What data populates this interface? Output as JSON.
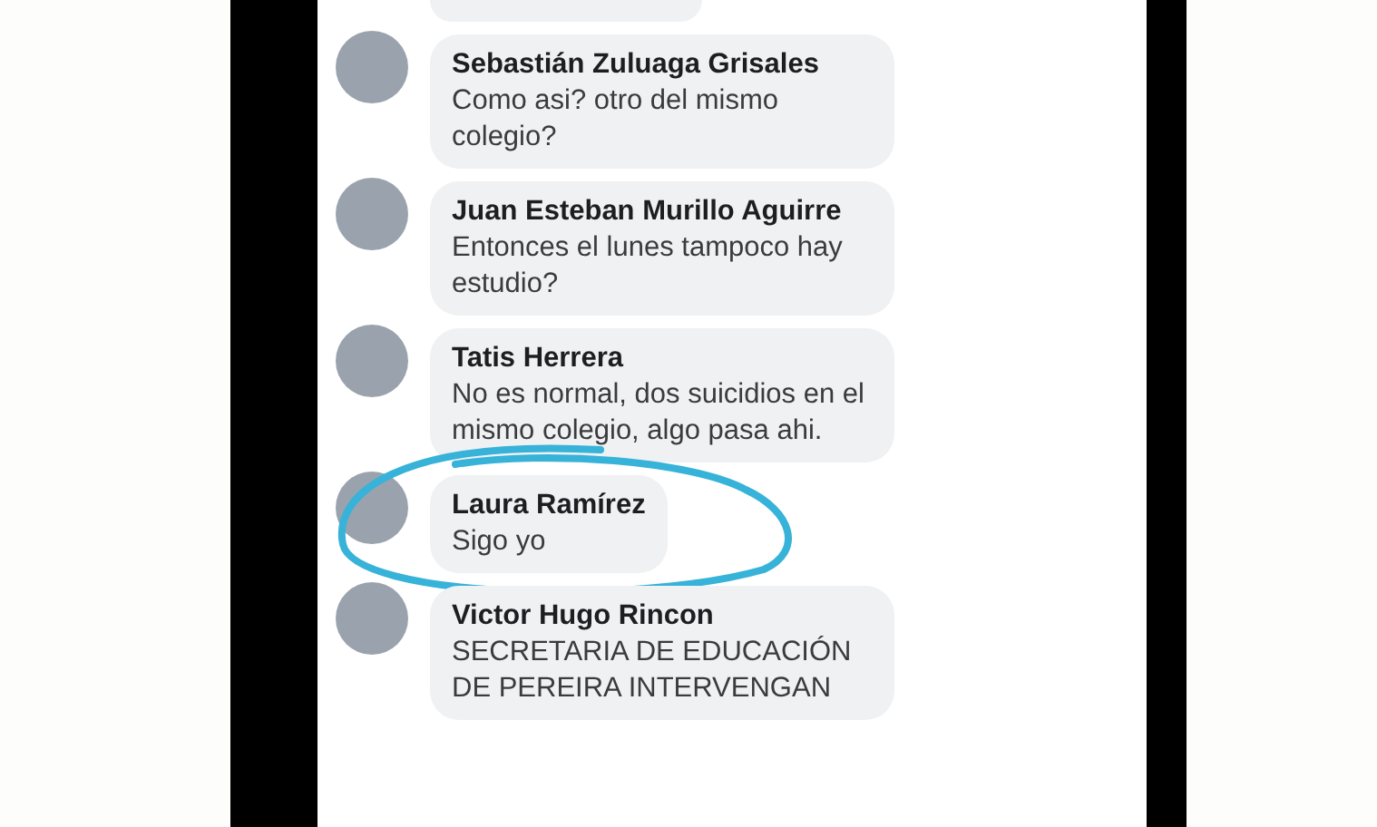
{
  "comments": [
    {
      "name": "Sebastián Zuluaga Grisales",
      "text": "Como asi? otro del mismo colegio?",
      "circled": false
    },
    {
      "name": "Juan Esteban Murillo Aguirre",
      "text": "Entonces el lunes tampoco hay estudio?",
      "circled": false
    },
    {
      "name": "Tatis Herrera",
      "text": "No es normal, dos suicidios en el mismo colegio, algo pasa ahi.",
      "circled": false
    },
    {
      "name": "Laura Ramírez",
      "text": "Sigo yo",
      "circled": true
    },
    {
      "name": "Victor Hugo Rincon",
      "text": "SECRETARIA DE EDUCACIÓN DE PEREIRA INTERVENGAN",
      "circled": false
    }
  ]
}
